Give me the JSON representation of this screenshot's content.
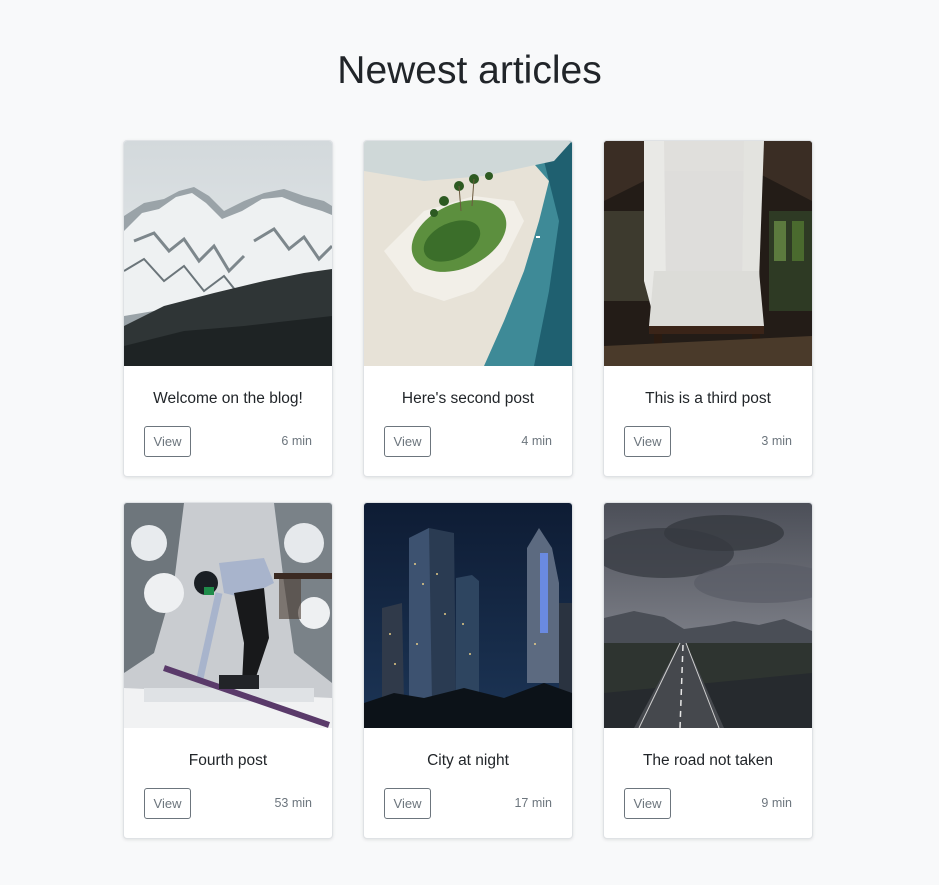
{
  "heading": "Newest articles",
  "articles": [
    {
      "title": "Welcome on the blog!",
      "button_label": "View",
      "read_time": "6 min",
      "image": "snowy-mountains-photo"
    },
    {
      "title": "Here's second post",
      "button_label": "View",
      "read_time": "4 min",
      "image": "tropical-island-photo"
    },
    {
      "title": "This is a third post",
      "button_label": "View",
      "read_time": "3 min",
      "image": "canopy-bed-photo"
    },
    {
      "title": "Fourth post",
      "button_label": "View",
      "read_time": "53 min",
      "image": "skier-photo"
    },
    {
      "title": "City at night",
      "button_label": "View",
      "read_time": "17 min",
      "image": "city-night-photo"
    },
    {
      "title": "The road not taken",
      "button_label": "View",
      "read_time": "9 min",
      "image": "stormy-road-photo"
    }
  ]
}
